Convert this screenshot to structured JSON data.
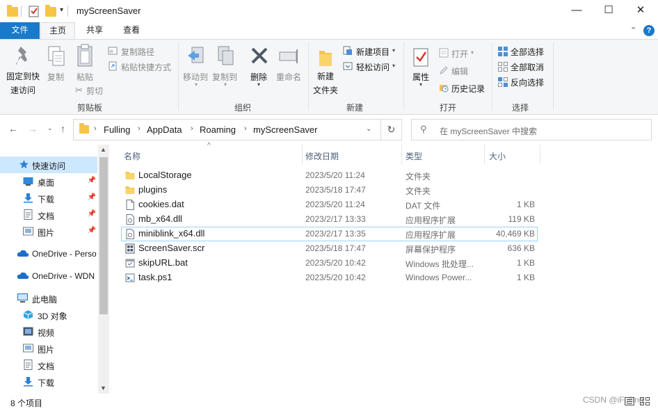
{
  "window": {
    "title": "myScreenSaver",
    "minimize_glyph": "—",
    "maximize_glyph": "☐",
    "close_glyph": "✕"
  },
  "tabs": [
    {
      "label": "文件"
    },
    {
      "label": "主页"
    },
    {
      "label": "共享"
    },
    {
      "label": "查看"
    }
  ],
  "ribbon": {
    "clipboard": {
      "group": "剪贴板",
      "pin": "固定到快\n速访问",
      "pin_l1": "固定到快",
      "pin_l2": "速访问",
      "copy": "复制",
      "paste": "粘贴",
      "copy_path": "复制路径",
      "paste_shortcut": "粘贴快捷方式",
      "cut": "剪切"
    },
    "organize": {
      "group": "组织",
      "move_to": "移动到",
      "copy_to": "复制到",
      "delete": "删除",
      "rename": "重命名"
    },
    "new": {
      "group": "新建",
      "new_folder_l1": "新建",
      "new_folder_l2": "文件夹",
      "new_item": "新建项目",
      "easy_access": "轻松访问"
    },
    "open": {
      "group": "打开",
      "properties": "属性",
      "open": "打开",
      "edit": "编辑",
      "history": "历史记录"
    },
    "select": {
      "group": "选择",
      "select_all": "全部选择",
      "select_none": "全部取消",
      "invert": "反向选择"
    }
  },
  "address": {
    "crumbs": [
      "Fulling",
      "AppData",
      "Roaming",
      "myScreenSaver"
    ]
  },
  "search": {
    "placeholder": "在 myScreenSaver 中搜索"
  },
  "sidebar": {
    "items": [
      {
        "label": "快速访问",
        "icon": "star-icon"
      },
      {
        "label": "桌面",
        "icon": "desktop-icon",
        "pinned": true
      },
      {
        "label": "下载",
        "icon": "download-icon",
        "pinned": true
      },
      {
        "label": "文档",
        "icon": "document-icon",
        "pinned": true
      },
      {
        "label": "图片",
        "icon": "pictures-icon",
        "pinned": true
      },
      {
        "label": "OneDrive - Perso",
        "icon": "cloud-icon"
      },
      {
        "label": "OneDrive - WDN",
        "icon": "cloud-icon"
      },
      {
        "label": "此电脑",
        "icon": "computer-icon"
      },
      {
        "label": "3D 对象",
        "icon": "3d-objects-icon"
      },
      {
        "label": "视频",
        "icon": "video-icon"
      },
      {
        "label": "图片",
        "icon": "pictures-icon"
      },
      {
        "label": "文档",
        "icon": "document-icon"
      },
      {
        "label": "下载",
        "icon": "download-icon"
      }
    ]
  },
  "columns": {
    "name": "名称",
    "date": "修改日期",
    "type": "类型",
    "size": "大小"
  },
  "files": [
    {
      "name": "LocalStorage",
      "date": "2023/5/20 11:24",
      "type": "文件夹",
      "size": "",
      "icon": "folder-icon"
    },
    {
      "name": "plugins",
      "date": "2023/5/18 17:47",
      "type": "文件夹",
      "size": "",
      "icon": "folder-icon"
    },
    {
      "name": "cookies.dat",
      "date": "2023/5/20 11:24",
      "type": "DAT 文件",
      "size": "1 KB",
      "icon": "dat-file-icon"
    },
    {
      "name": "mb_x64.dll",
      "date": "2023/2/17 13:33",
      "type": "应用程序扩展",
      "size": "119 KB",
      "icon": "dll-file-icon"
    },
    {
      "name": "miniblink_x64.dll",
      "date": "2023/2/17 13:35",
      "type": "应用程序扩展",
      "size": "40,469 KB",
      "icon": "dll-file-icon",
      "selected": true
    },
    {
      "name": "ScreenSaver.scr",
      "date": "2023/5/18 17:47",
      "type": "屏幕保护程序",
      "size": "636 KB",
      "icon": "screensaver-file-icon"
    },
    {
      "name": "skipURL.bat",
      "date": "2023/5/20 10:42",
      "type": "Windows 批处理...",
      "size": "1 KB",
      "icon": "bat-file-icon"
    },
    {
      "name": "task.ps1",
      "date": "2023/5/20 10:42",
      "type": "Windows Power...",
      "size": "1 KB",
      "icon": "ps1-file-icon"
    }
  ],
  "status": {
    "count": "8 个项目",
    "watermark": "CSDN @iFulling"
  },
  "colors": {
    "accent": "#1979ca",
    "selection": "#cce8ff",
    "folder": "#f6c544"
  }
}
